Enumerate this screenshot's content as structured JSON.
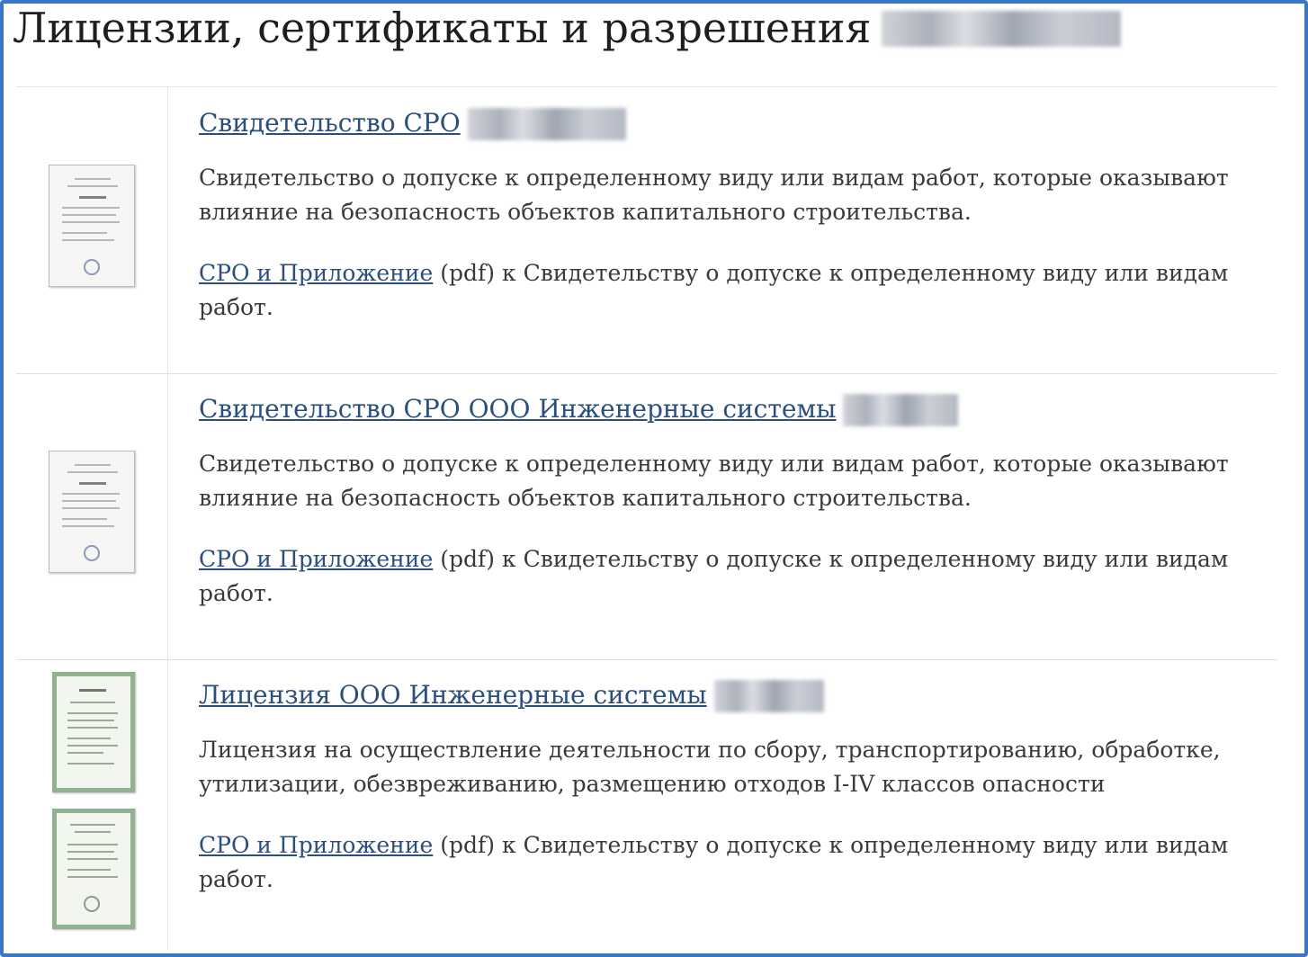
{
  "page": {
    "title": "Лицензии, сертификаты и разрешения"
  },
  "items": [
    {
      "title": "Свидетельство СРО",
      "description": "Свидетельство о допуске к определенному виду или видам работ, которые оказывают влияние на безопасность объектов капитального строительства.",
      "file_link": "СРО и Приложение",
      "file_format": "(pdf)",
      "file_suffix": "к Свидетельству о допуске к определенному виду или видам работ."
    },
    {
      "title": "Свидетельство СРО ООО Инженерные системы",
      "description": "Свидетельство о допуске к определенному виду или видам работ, которые оказывают влияние на безопасность объектов капитального строительства.",
      "file_link": "СРО и Приложение",
      "file_format": "(pdf)",
      "file_suffix": "к Свидетельству о допуске к определенному виду или видам работ."
    },
    {
      "title": "Лицензия ООО Инженерные системы",
      "description": "Лицензия на осуществление деятельности по сбору, транспортированию, обработке, утилизации, обезвреживанию, размещению отходов I-IV классов опасности",
      "file_link": "СРО и Приложение",
      "file_format": "(pdf)",
      "file_suffix": "к Свидетельству о допуске к определенному виду или видам работ."
    }
  ],
  "colors": {
    "frame_border": "#3a76c4",
    "link": "#2a4f7e",
    "text": "#3a3a3a",
    "license_frame": "#8fb391"
  }
}
